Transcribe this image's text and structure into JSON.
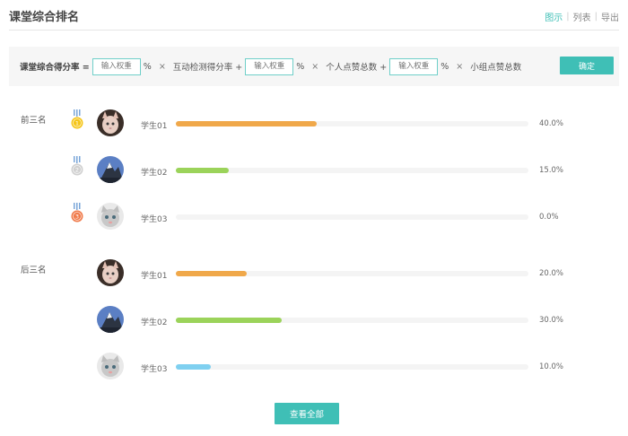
{
  "header": {
    "title": "课堂综合排名",
    "views": [
      "图示",
      "列表",
      "导出"
    ]
  },
  "formula": {
    "lead_label": "课堂综合得分率 =",
    "segments": [
      {
        "placeholder": "输入权重",
        "pct": "%",
        "times": "×",
        "label": "互动检测得分率 +"
      },
      {
        "placeholder": "输入权重",
        "pct": "%",
        "times": "×",
        "label": "个人点赞总数 +"
      },
      {
        "placeholder": "输入权重",
        "pct": "%",
        "times": "×",
        "label": "小组点赞总数"
      }
    ],
    "confirm_label": "确定"
  },
  "top_group": {
    "label": "前三名",
    "rows": [
      {
        "medal_rank": "1",
        "medal_color": "#f5c518",
        "name": "学生01",
        "percent": 40.0,
        "value_label": "40.0%",
        "bar_color": "#f0a84a",
        "avatar": "cat"
      },
      {
        "medal_rank": "2",
        "medal_color": "#d0d0d0",
        "name": "学生02",
        "percent": 15.0,
        "value_label": "15.0%",
        "bar_color": "#9bd35a",
        "avatar": "mountain"
      },
      {
        "medal_rank": "3",
        "medal_color": "#f07a4a",
        "name": "学生03",
        "percent": 0.0,
        "value_label": "0.0%",
        "bar_color": "#7fd0f0",
        "avatar": "kitten"
      }
    ]
  },
  "bottom_group": {
    "label": "后三名",
    "rows": [
      {
        "name": "学生01",
        "percent": 20.0,
        "value_label": "20.0%",
        "bar_color": "#f0a84a",
        "avatar": "cat"
      },
      {
        "name": "学生02",
        "percent": 30.0,
        "value_label": "30.0%",
        "bar_color": "#9bd35a",
        "avatar": "mountain"
      },
      {
        "name": "学生03",
        "percent": 10.0,
        "value_label": "10.0%",
        "bar_color": "#7fd0f0",
        "avatar": "kitten"
      }
    ]
  },
  "view_all_label": "查看全部"
}
